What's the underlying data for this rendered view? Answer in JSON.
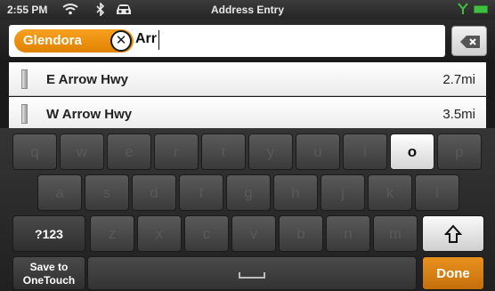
{
  "status_bar": {
    "time": "2:55 PM",
    "icons": [
      "wifi-icon",
      "bluetooth-icon",
      "traffic-icon"
    ],
    "title": "Address Entry",
    "signal_color": "#3fbf3f",
    "battery_color": "#3fbf3f"
  },
  "search": {
    "city": "Glendora",
    "query": "Arr",
    "chip_color": "#f39a1b"
  },
  "results": [
    {
      "name": "E Arrow Hwy",
      "distance": "2.7mi"
    },
    {
      "name": "W Arrow Hwy",
      "distance": "3.5mi"
    }
  ],
  "keyboard": {
    "row1": [
      "q",
      "w",
      "e",
      "r",
      "t",
      "y",
      "u",
      "i",
      "o",
      "p"
    ],
    "row2": [
      "a",
      "s",
      "d",
      "f",
      "g",
      "h",
      "j",
      "k",
      "l"
    ],
    "row3": [
      "z",
      "x",
      "c",
      "v",
      "b",
      "n",
      "m"
    ],
    "enabled_keys": [
      "o"
    ],
    "numbers_label": "?123",
    "shift_label": "⇧",
    "save_label_line1": "Save to",
    "save_label_line2": "OneTouch",
    "space_label": "␣",
    "done_label": "Done",
    "done_color": "#e08a18"
  }
}
